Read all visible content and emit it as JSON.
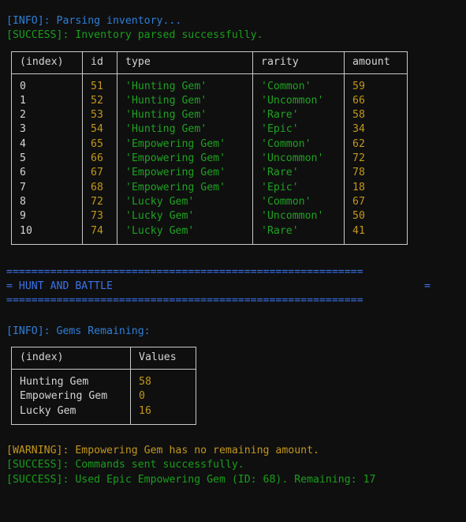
{
  "theme": {
    "background": "#0f0f10",
    "info_color": "#2f7fd6",
    "success_color": "#1a9e1a",
    "warning_color": "#c2971a",
    "string_color": "#1fa21f",
    "number_color": "#c2971a",
    "text_color": "#d4d4d4",
    "banner_color": "#3b72e8",
    "table_border_color": "#c9c9c9"
  },
  "log_top": {
    "parsing": {
      "tag": "[INFO]:",
      "message": " Parsing inventory..."
    },
    "parsed": {
      "tag": "[SUCCESS]:",
      "message": " Inventory parsed successfully."
    }
  },
  "inventory_table": {
    "headers": [
      "(index)",
      "id",
      "type",
      "rarity",
      "amount"
    ],
    "rows": [
      {
        "index": "0",
        "id": "51",
        "type": "'Hunting Gem'",
        "rarity": "'Common'",
        "amount": "59"
      },
      {
        "index": "1",
        "id": "52",
        "type": "'Hunting Gem'",
        "rarity": "'Uncommon'",
        "amount": "66"
      },
      {
        "index": "2",
        "id": "53",
        "type": "'Hunting Gem'",
        "rarity": "'Rare'",
        "amount": "58"
      },
      {
        "index": "3",
        "id": "54",
        "type": "'Hunting Gem'",
        "rarity": "'Epic'",
        "amount": "34"
      },
      {
        "index": "4",
        "id": "65",
        "type": "'Empowering Gem'",
        "rarity": "'Common'",
        "amount": "62"
      },
      {
        "index": "5",
        "id": "66",
        "type": "'Empowering Gem'",
        "rarity": "'Uncommon'",
        "amount": "72"
      },
      {
        "index": "6",
        "id": "67",
        "type": "'Empowering Gem'",
        "rarity": "'Rare'",
        "amount": "78"
      },
      {
        "index": "7",
        "id": "68",
        "type": "'Empowering Gem'",
        "rarity": "'Epic'",
        "amount": "18"
      },
      {
        "index": "8",
        "id": "72",
        "type": "'Lucky Gem'",
        "rarity": "'Common'",
        "amount": "67"
      },
      {
        "index": "9",
        "id": "73",
        "type": "'Lucky Gem'",
        "rarity": "'Uncommon'",
        "amount": "50"
      },
      {
        "index": "10",
        "id": "74",
        "type": "'Lucky Gem'",
        "rarity": "'Rare'",
        "amount": "41"
      }
    ]
  },
  "banner": {
    "rule": "=========================================================",
    "left_marker": "= ",
    "title": "HUNT AND BATTLE",
    "right_marker": "="
  },
  "gems_remaining_log": {
    "tag": "[INFO]:",
    "message": " Gems Remaining:"
  },
  "gems_table": {
    "headers": [
      "(index)",
      "Values"
    ],
    "rows": [
      {
        "index": "Hunting Gem",
        "value": "58"
      },
      {
        "index": "Empowering Gem",
        "value": "0"
      },
      {
        "index": "Lucky Gem",
        "value": "16"
      }
    ]
  },
  "log_bottom": {
    "warning": {
      "tag": "[WARNING]:",
      "message": " Empowering Gem has no remaining amount."
    },
    "commands_sent": {
      "tag": "[SUCCESS]:",
      "message": " Commands sent successfully."
    },
    "gem_used": {
      "tag": "[SUCCESS]:",
      "message": " Used Epic Empowering Gem (ID: 68). Remaining: 17"
    }
  }
}
